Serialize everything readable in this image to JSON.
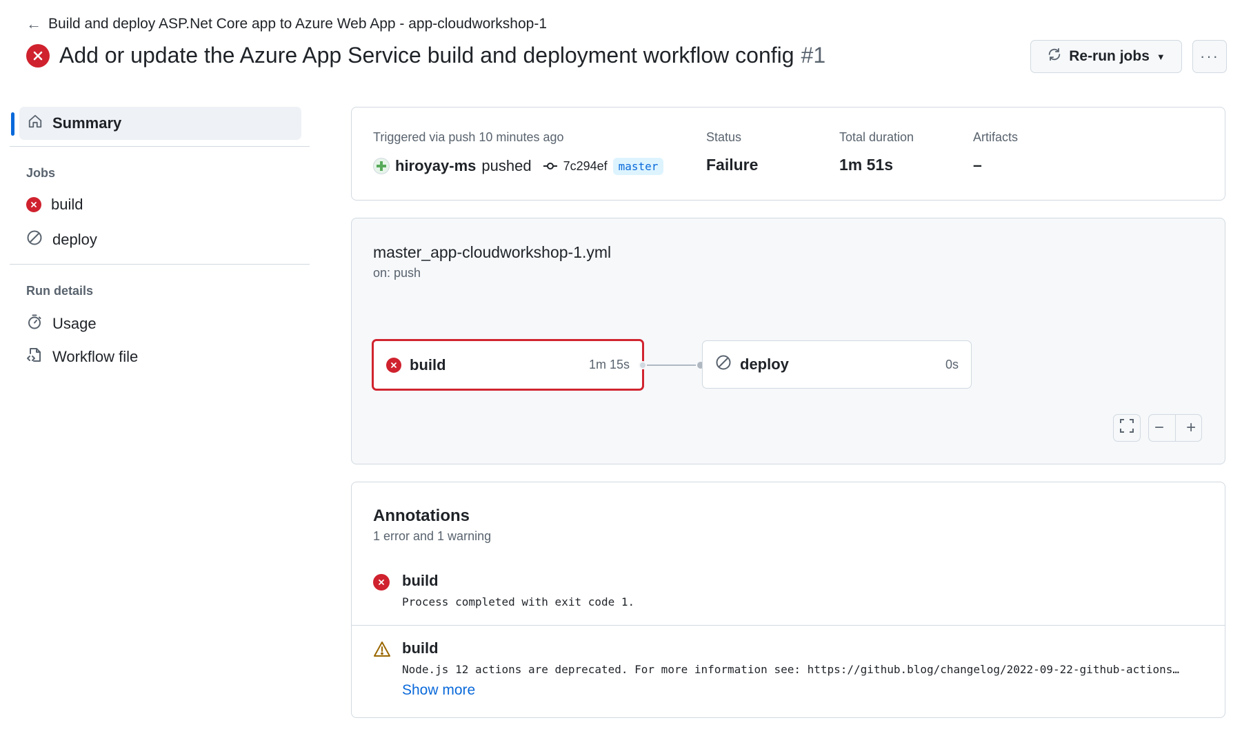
{
  "header": {
    "back_link": "Build and deploy ASP.Net Core app to Azure Web App - app-cloudworkshop-1",
    "title": "Add or update the Azure App Service build and deployment workflow config",
    "run_number": "#1",
    "rerun_label": "Re-run jobs",
    "more_label": "···"
  },
  "sidebar": {
    "summary_label": "Summary",
    "jobs_heading": "Jobs",
    "jobs": [
      {
        "label": "build",
        "status": "failure"
      },
      {
        "label": "deploy",
        "status": "skipped"
      }
    ],
    "run_details_heading": "Run details",
    "details": [
      {
        "label": "Usage",
        "icon": "stopwatch-icon"
      },
      {
        "label": "Workflow file",
        "icon": "file-code-icon"
      }
    ]
  },
  "summary": {
    "trigger_text": "Triggered via push 10 minutes ago",
    "actor": "hiroyay-ms",
    "action": "pushed",
    "commit": "7c294ef",
    "branch": "master",
    "status_label": "Status",
    "status_value": "Failure",
    "duration_label": "Total duration",
    "duration_value": "1m 51s",
    "artifacts_label": "Artifacts",
    "artifacts_value": "–"
  },
  "workflow": {
    "file": "master_app-cloudworkshop-1.yml",
    "on": "on: push",
    "jobs": [
      {
        "name": "build",
        "time": "1m 15s",
        "status": "failure"
      },
      {
        "name": "deploy",
        "time": "0s",
        "status": "skipped"
      }
    ]
  },
  "annotations": {
    "title": "Annotations",
    "subtitle": "1 error and 1 warning",
    "items": [
      {
        "type": "error",
        "job": "build",
        "message": "Process completed with exit code 1."
      },
      {
        "type": "warning",
        "job": "build",
        "message": "Node.js 12 actions are deprecated. For more information see: https://github.blog/changelog/2022-09-22-github-actions…"
      }
    ],
    "show_more": "Show more"
  },
  "colors": {
    "error": "#cf222e",
    "warning": "#9a6700",
    "link": "#0969da",
    "highlight_box": "#d1242f"
  }
}
